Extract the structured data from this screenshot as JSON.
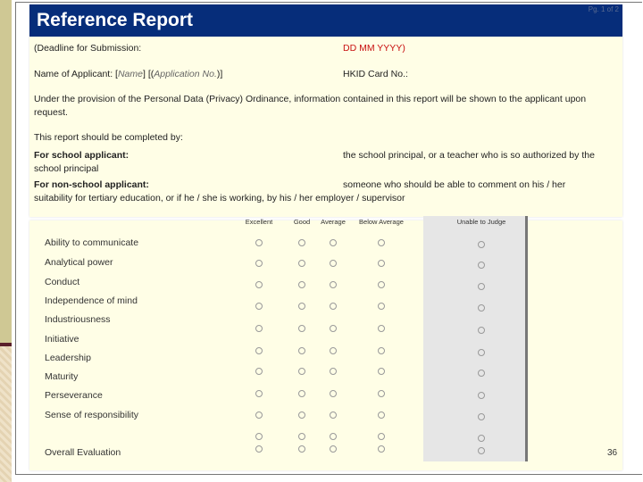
{
  "header": {
    "title": "Reference  Report",
    "page_indicator": "Pg. 1 of 2"
  },
  "form": {
    "deadline_label": "(Deadline for Submission:",
    "deadline_value": "DD MM YYYY)",
    "applicant_label": "Name of Applicant:  [",
    "applicant_name": "Name",
    "applicant_mid": "] [(",
    "application_no": "Application No.",
    "applicant_end": ")]",
    "hkid_label": "HKID Card No.:",
    "privacy_line1": "Under the provision of the Personal Data (Privacy) Ordinance, information contained in this report will be shown to the applicant upon",
    "privacy_line2": "request.",
    "completed_by": "This report should be completed by:",
    "school_label": "For school applicant:",
    "school_text1": "the school principal, or a teacher who is so authorized by the",
    "school_text2": "school principal",
    "nonschool_label": "For non-school applicant:",
    "nonschool_text1": "someone who should be able to comment on his / her",
    "nonschool_text2": "suitability for tertiary education, or if he / she is working, by his / her employer / supervisor"
  },
  "ratings": {
    "columns": [
      "Excellent",
      "Good",
      "Average",
      "Below Average",
      "Unable to Judge"
    ],
    "rows": [
      "Ability to communicate",
      "Analytical power",
      "Conduct",
      "Independence of mind",
      "Industriousness",
      "Initiative",
      "Leadership",
      "Maturity",
      "Perseverance",
      "Sense of responsibility",
      "Overall Evaluation"
    ]
  },
  "slide_number": "36"
}
